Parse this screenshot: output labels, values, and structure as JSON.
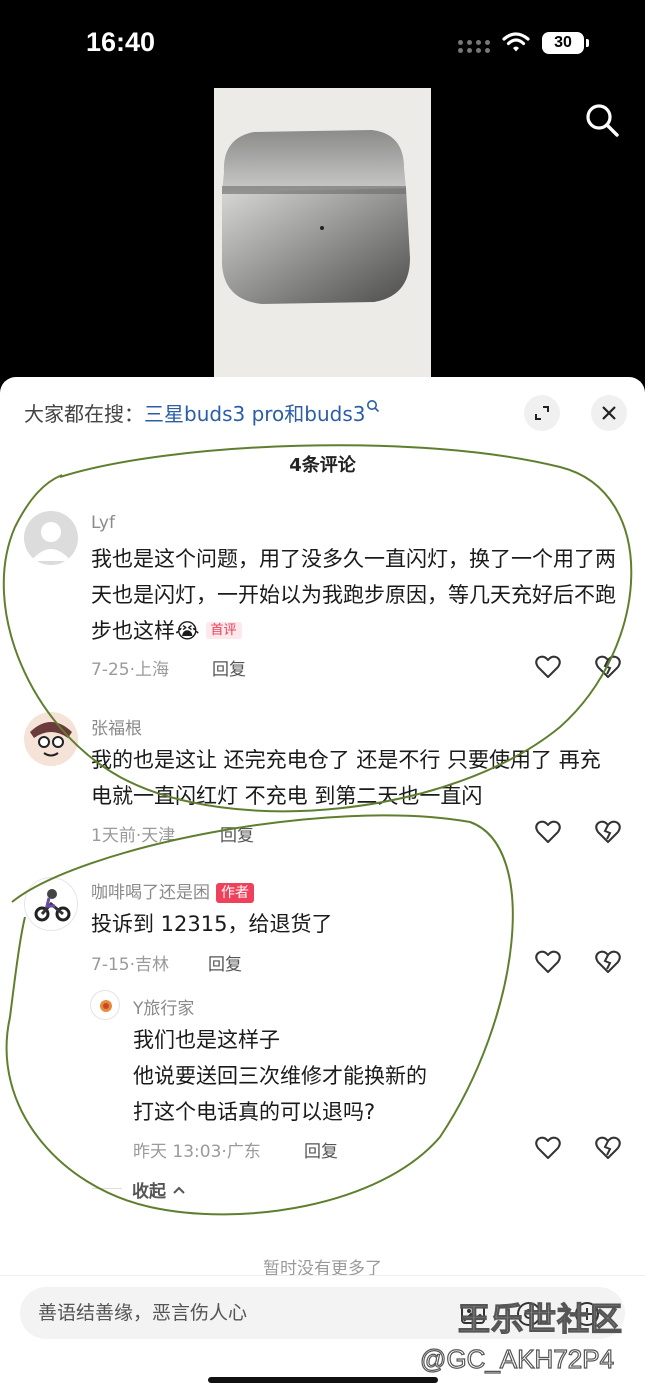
{
  "status_bar": {
    "time": "16:40",
    "battery": "30"
  },
  "sheet": {
    "search_prefix": "大家都在搜：",
    "search_link": "三星buds3 pro和buds3",
    "comment_count": "4条评论",
    "no_more": "暂时没有更多了",
    "collapse": "收起"
  },
  "comments": [
    {
      "user": "Lyf",
      "text": "我也是这个问题，用了没多久一直闪灯，换了一个用了两天也是闪灯，一开始以为我跑步原因，等几天充好后不跑步也这样😭",
      "badge": "首评",
      "date": "7-25",
      "location": "上海",
      "reply_label": "回复"
    },
    {
      "user": "张福根",
      "text": "我的也是这让 还完充电仓了 还是不行 只要使用了 再充电就一直闪红灯 不充电 到第二天也一直闪",
      "date": "1天前",
      "location": "天津",
      "reply_label": "回复"
    },
    {
      "user": "咖啡喝了还是困",
      "author_tag": "作者",
      "text": "投诉到 12315，给退货了",
      "date": "7-15",
      "location": "吉林",
      "reply_label": "回复"
    },
    {
      "user": "Y旅行家",
      "lines": [
        "我们也是这样子",
        "他说要送回三次维修才能换新的",
        "打这个电话真的可以退吗?"
      ],
      "date": "昨天 13:03",
      "location": "广东",
      "reply_label": "回复"
    }
  ],
  "input": {
    "placeholder": "善语结善缘，恶言伤人心"
  },
  "watermark": {
    "line1": "王乐世社区",
    "line2": "@GC_AKH72P4"
  },
  "colors": {
    "link": "#2b5ea6",
    "author_tag": "#f0415c",
    "scribble": "#5f7f2e"
  }
}
